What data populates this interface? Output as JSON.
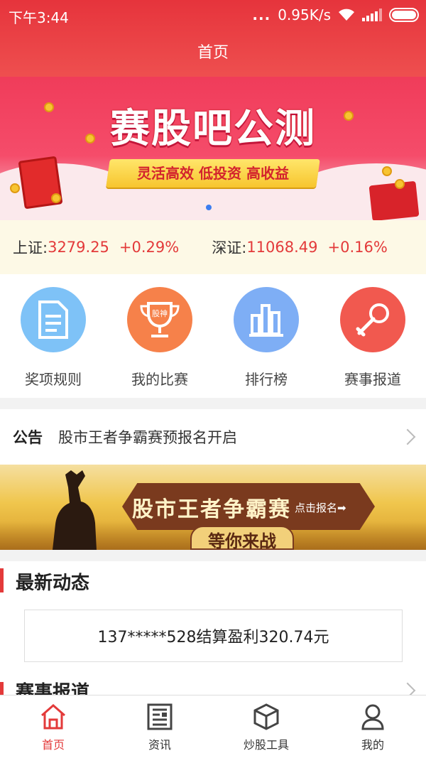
{
  "status_bar": {
    "time": "下午3:44",
    "dots": "...",
    "speed": "0.95K/s"
  },
  "header": {
    "title": "首页"
  },
  "banner": {
    "title": "赛股吧公测",
    "subtitle": "灵活高效 低投资 高收益"
  },
  "indices": [
    {
      "label": "上证:",
      "value": "3279.25",
      "change": "+0.29%"
    },
    {
      "label": "深证:",
      "value": "11068.49",
      "change": "+0.16%"
    }
  ],
  "shortcuts": [
    {
      "label": "奖项规则",
      "icon": "document-icon",
      "color": "#7ec2f7"
    },
    {
      "label": "我的比赛",
      "icon": "trophy-icon",
      "color": "#f6814a",
      "icon_text": "股神"
    },
    {
      "label": "排行榜",
      "icon": "bar-chart-icon",
      "color": "#7eaef5"
    },
    {
      "label": "赛事报道",
      "icon": "microphone-icon",
      "color": "#f1594f"
    }
  ],
  "notice": {
    "tag": "公告",
    "text": "股市王者争霸赛预报名开启"
  },
  "promo": {
    "title": "股市王者争霸赛",
    "cta": "点击报名➡",
    "subtitle": "等你来战"
  },
  "news": {
    "section_title": "最新动态",
    "items": [
      "137*****528结算盈利320.74元"
    ]
  },
  "report": {
    "section_title": "赛事报道"
  },
  "tabbar": [
    {
      "label": "首页",
      "icon": "home-icon",
      "active": true
    },
    {
      "label": "资讯",
      "icon": "news-icon",
      "active": false
    },
    {
      "label": "炒股工具",
      "icon": "cube-icon",
      "active": false
    },
    {
      "label": "我的",
      "icon": "user-icon",
      "active": false
    }
  ],
  "colors": {
    "primary": "#e33a3a",
    "index_bg": "#fdf9e6"
  }
}
